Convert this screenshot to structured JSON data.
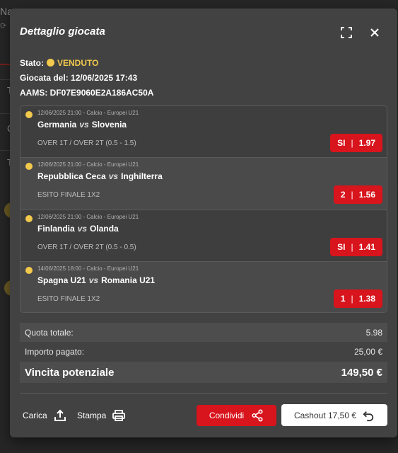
{
  "background": {
    "title": "Na",
    "letters": [
      "T",
      "C",
      "T"
    ]
  },
  "modal": {
    "title": "Dettaglio giocata",
    "expand_icon": "fullscreen-icon",
    "close_icon": "close-icon"
  },
  "info": {
    "status_label": "Stato:",
    "status_value": "VENDUTO",
    "date_label": "Giocata del:",
    "date_value": "12/06/2025 17:43",
    "aams_label": "AAMS:",
    "aams_value": "DF07E9060E2A186AC50A"
  },
  "bets": [
    {
      "meta": "12/06/2025 21:00 - Calcio - Europei U21",
      "home": "Germania",
      "vs": "vs",
      "away": "Slovenia",
      "market": "OVER 1T / OVER 2T (0.5 - 1.5)",
      "pick": "SI",
      "odds": "1.97"
    },
    {
      "meta": "12/06/2025 21:00 - Calcio - Europei U21",
      "home": "Repubblica Ceca",
      "vs": "vs",
      "away": "Inghilterra",
      "market": "ESITO FINALE 1X2",
      "pick": "2",
      "odds": "1.56"
    },
    {
      "meta": "12/06/2025 21:00 - Calcio - Europei U21",
      "home": "Finlandia",
      "vs": "vs",
      "away": "Olanda",
      "market": "OVER 1T / OVER 2T (0.5 - 0.5)",
      "pick": "SI",
      "odds": "1.41"
    },
    {
      "meta": "14/06/2025 18:00 - Calcio - Europei U21",
      "home": "Spagna U21",
      "vs": "vs",
      "away": "Romania U21",
      "market": "ESITO FINALE 1X2",
      "pick": "1",
      "odds": "1.38"
    }
  ],
  "summary": {
    "total_odds_label": "Quota totale:",
    "total_odds_value": "5.98",
    "paid_label": "Importo pagato:",
    "paid_value": "25,00 €",
    "win_label": "Vincita potenziale",
    "win_value": "149,50 €"
  },
  "footer": {
    "upload_label": "Carica",
    "print_label": "Stampa",
    "share_label": "Condividi",
    "cashout_label": "Cashout 17,50 €"
  },
  "colors": {
    "accent_red": "#d8141c",
    "status_yellow": "#f2c94c",
    "modal_bg": "#424242"
  }
}
